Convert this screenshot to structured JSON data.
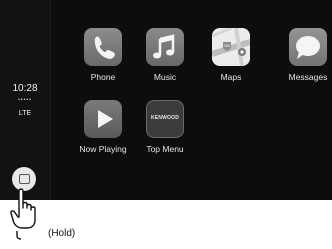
{
  "status": {
    "time": "10:28",
    "signal_dots": "•••••",
    "network": "LTE"
  },
  "apps": [
    {
      "label": "Phone"
    },
    {
      "label": "Music"
    },
    {
      "label": "Maps"
    },
    {
      "label": "Messages"
    },
    {
      "label": "Now Playing"
    },
    {
      "label": "Top Menu",
      "tile_text": "KENWOOD"
    }
  ],
  "maps_badge": "280",
  "annotation": {
    "text": "(Hold)"
  },
  "colors": {
    "screen_bg": "#0d0d0d",
    "tile_gray": "#7a7a7a",
    "label_text": "#e6e6e6"
  }
}
